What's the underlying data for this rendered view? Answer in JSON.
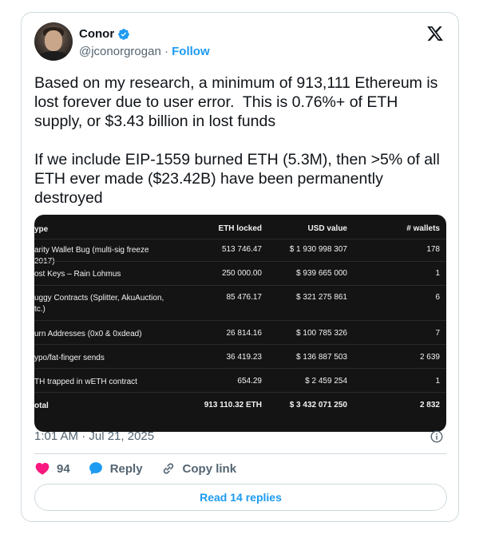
{
  "author": {
    "name": "Conor",
    "handle": "@jconorgrogan",
    "separator": "·",
    "follow_label": "Follow"
  },
  "tweet": {
    "paragraph1": "Based on my research, a minimum of 913,111 Ethereum is lost forever due to user error.  This is 0.76%+ of ETH supply, or $3.43 billion in lost funds",
    "paragraph2": "If we include EIP-1559 burned ETH (5.3M), then >5% of all ETH ever made ($23.42B) have been permanently destroyed"
  },
  "table": {
    "headers": [
      "ype",
      "ETH locked",
      "USD value",
      "# wallets"
    ],
    "rows": [
      [
        "arity Wallet Bug (multi-sig freeze 2017)",
        "513 746.47",
        "$ 1 930 998 307",
        "178"
      ],
      [
        "ost Keys – Rain Lohmus",
        "250 000.00",
        "$ 939 665 000",
        "1"
      ],
      [
        "uggy Contracts (Splitter, AkuAuction, tc.)",
        "85 476.17",
        "$ 321 275 861",
        "6"
      ],
      [
        "urn Addresses (0x0 & 0xdead)",
        "26 814.16",
        "$ 100 785 326",
        "7"
      ],
      [
        "ypo/fat-finger sends",
        "36 419.23",
        "$ 136 887 503",
        "2 639"
      ],
      [
        "TH trapped in wETH contract",
        "654.29",
        "$ 2 459 254",
        "1"
      ]
    ],
    "total": [
      "otal",
      "913 110.32 ETH",
      "$ 3 432 071 250",
      "2 832"
    ]
  },
  "timestamp": "1:01 AM · Jul 21, 2025",
  "actions": {
    "likes": "94",
    "reply_label": "Reply",
    "copy_link_label": "Copy link"
  },
  "read_replies_label": "Read 14 replies",
  "colors": {
    "accent": "#1d9bf0",
    "like": "#f91880",
    "text": "#0f1419",
    "muted": "#536471",
    "border": "#cfd9de",
    "table_bg": "#141414"
  },
  "icons": [
    "verified-badge-icon",
    "x-logo-icon",
    "info-icon",
    "heart-icon",
    "reply-bubble-icon",
    "link-icon"
  ]
}
